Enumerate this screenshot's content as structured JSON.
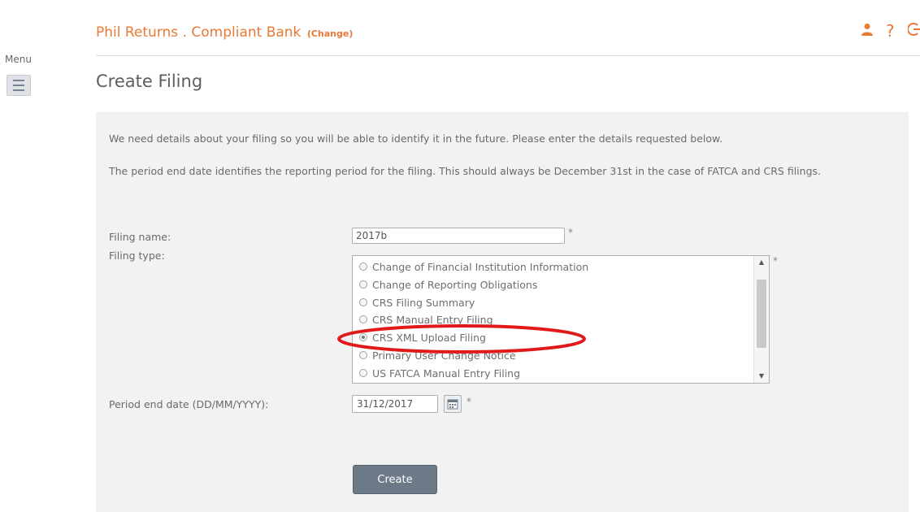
{
  "nav": {
    "menu_label": "Menu"
  },
  "header": {
    "user_name": "Phil Returns",
    "separator": ".",
    "institution": "Compliant Bank",
    "change_label": "(Change)"
  },
  "page": {
    "title": "Create Filing"
  },
  "intro": {
    "line1": "We need details about your filing so you will be able to identify it in the future. Please enter the details requested below.",
    "line2": "The period end date identifies the reporting period for the filing. This should always be December 31st in the case of FATCA and CRS filings."
  },
  "form": {
    "filing_name_label": "Filing name:",
    "filing_name_value": "2017b",
    "filing_type_label": "Filing type:",
    "filing_type_options": [
      {
        "label": "Change of Financial Institution Information",
        "selected": false
      },
      {
        "label": "Change of Reporting Obligations",
        "selected": false
      },
      {
        "label": "CRS Filing Summary",
        "selected": false
      },
      {
        "label": "CRS Manual Entry Filing",
        "selected": false
      },
      {
        "label": "CRS XML Upload Filing",
        "selected": true
      },
      {
        "label": "Primary User Change Notice",
        "selected": false
      },
      {
        "label": "US FATCA Manual Entry Filing",
        "selected": false
      }
    ],
    "period_end_label": "Period end date (DD/MM/YYYY):",
    "period_end_value": "31/12/2017",
    "required_marker": "*",
    "create_label": "Create"
  },
  "colors": {
    "accent": "#e87a36",
    "annotation": "#e01a1a",
    "panel": "#f2f2f2",
    "button": "#6b7a86"
  }
}
